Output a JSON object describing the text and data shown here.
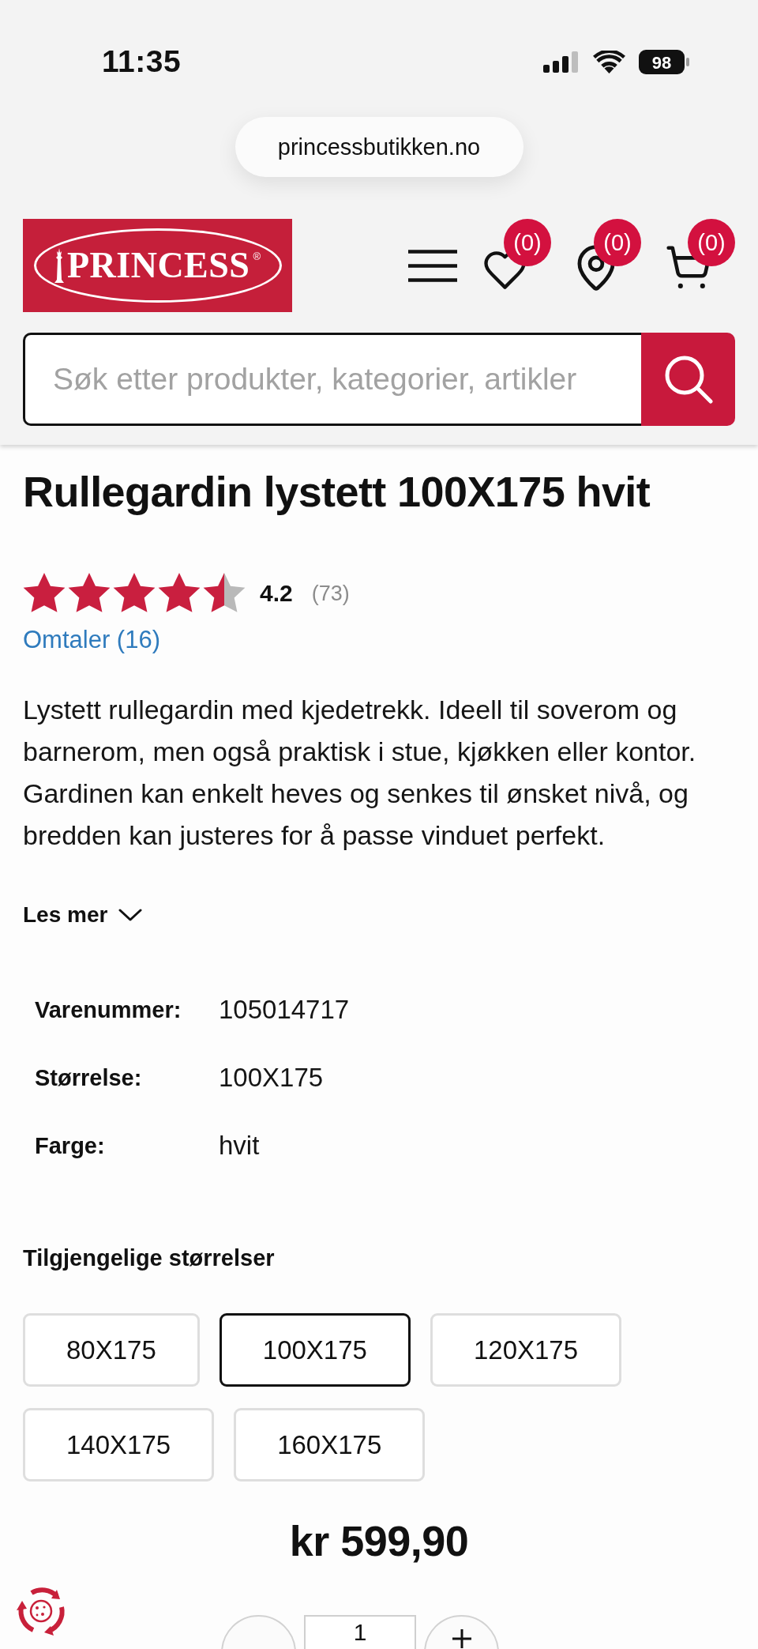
{
  "status_bar": {
    "time": "11:35",
    "battery": "98"
  },
  "browser": {
    "url": "princessbutikken.no"
  },
  "header": {
    "logo": {
      "text": "PRINCESS",
      "mark": "®"
    },
    "actions": [
      {
        "kind": "menu"
      },
      {
        "kind": "wishlist",
        "count": "(0)"
      },
      {
        "kind": "stores",
        "count": "(0)"
      },
      {
        "kind": "cart",
        "count": "(0)"
      }
    ],
    "search": {
      "placeholder": "Søk etter produkter, kategorier, artikler"
    }
  },
  "product": {
    "title": "Rullegardin lystett 100X175 hvit",
    "rating": {
      "stars": 4.5,
      "score": "4.2",
      "count": "(73)"
    },
    "reviews_link": "Omtaler (16)",
    "description": "Lystett rullegardin med kjedetrekk. Ideell til soverom og barnerom, men også praktisk i stue, kjøkken eller kontor. Gardinen kan enkelt heves og senkes til ønsket nivå, og bredden kan justeres for å passe vinduet perfekt.",
    "read_more": "Les mer",
    "specs": [
      {
        "label": "Varenummer:",
        "value": "105014717"
      },
      {
        "label": "Størrelse:",
        "value": "100X175"
      },
      {
        "label": "Farge:",
        "value": "hvit"
      }
    ],
    "sizes_heading": "Tilgjengelige størrelser",
    "sizes": [
      {
        "label": "80X175",
        "selected": false
      },
      {
        "label": "100X175",
        "selected": true
      },
      {
        "label": "120X175",
        "selected": false
      },
      {
        "label": "140X175",
        "selected": false
      },
      {
        "label": "160X175",
        "selected": false
      }
    ],
    "price": "kr 599,90",
    "quantity": {
      "value": "1"
    }
  }
}
